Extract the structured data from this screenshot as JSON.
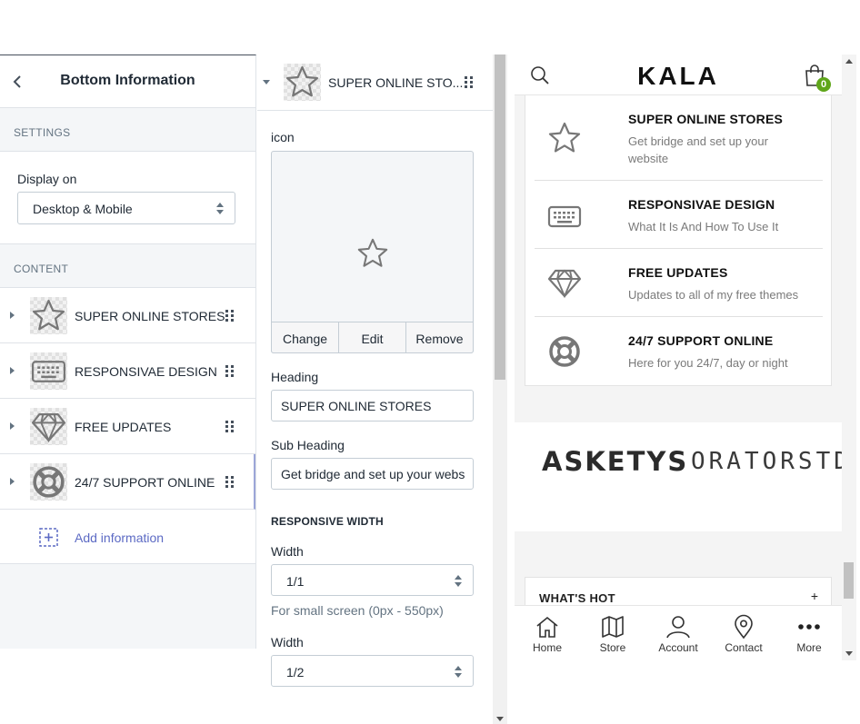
{
  "left_panel": {
    "title": "Bottom Information",
    "settings_label": "SETTINGS",
    "display_on_label": "Display on",
    "display_on_value": "Desktop & Mobile",
    "content_label": "CONTENT",
    "items": [
      {
        "label": "SUPER ONLINE STORES",
        "icon": "star-icon"
      },
      {
        "label": "RESPONSIVAE DESIGN",
        "icon": "keyboard-icon"
      },
      {
        "label": "FREE UPDATES",
        "icon": "diamond-icon"
      },
      {
        "label": "24/7 SUPPORT ONLINE",
        "icon": "lifebuoy-icon"
      }
    ],
    "add_label": "Add information"
  },
  "editor": {
    "title": "SUPER ONLINE STO...",
    "icon_label": "icon",
    "change_label": "Change",
    "edit_label": "Edit",
    "remove_label": "Remove",
    "heading_label": "Heading",
    "heading_value": "SUPER ONLINE STORES",
    "subheading_label": "Sub Heading",
    "subheading_value": "Get bridge and set up your webs",
    "responsive_label": "RESPONSIVE WIDTH",
    "width1_label": "Width",
    "width1_value": "1/1",
    "width1_help": "For small screen (0px - 550px)",
    "width2_label": "Width",
    "width2_value": "1/2"
  },
  "preview": {
    "logo": "KALA",
    "cart_count": "0",
    "items": [
      {
        "heading": "SUPER ONLINE STORES",
        "sub": "Get bridge and set up your website",
        "icon": "star-icon"
      },
      {
        "heading": "RESPONSIVAE DESIGN",
        "sub": "What It Is And How To Use It",
        "icon": "keyboard-icon"
      },
      {
        "heading": "FREE UPDATES",
        "sub": "Updates to all of my free themes",
        "icon": "diamond-icon"
      },
      {
        "heading": "24/7 SUPPORT ONLINE",
        "sub": "Here for you 24/7, day or night",
        "icon": "lifebuoy-icon"
      }
    ],
    "brands": [
      "ASKETYS",
      "ORATORSTD"
    ],
    "hot_label": "WHAT'S HOT",
    "hot_toggle": "+",
    "tabs": [
      {
        "label": "Home",
        "icon": "home-icon"
      },
      {
        "label": "Store",
        "icon": "map-icon"
      },
      {
        "label": "Account",
        "icon": "user-icon"
      },
      {
        "label": "Contact",
        "icon": "location-pin-icon"
      },
      {
        "label": "More",
        "icon": "more-dots-icon"
      }
    ]
  },
  "colors": {
    "accent": "#5c6ac4",
    "badge": "#5fa61a",
    "border": "#c4cdd5",
    "muted_text": "#637381"
  }
}
